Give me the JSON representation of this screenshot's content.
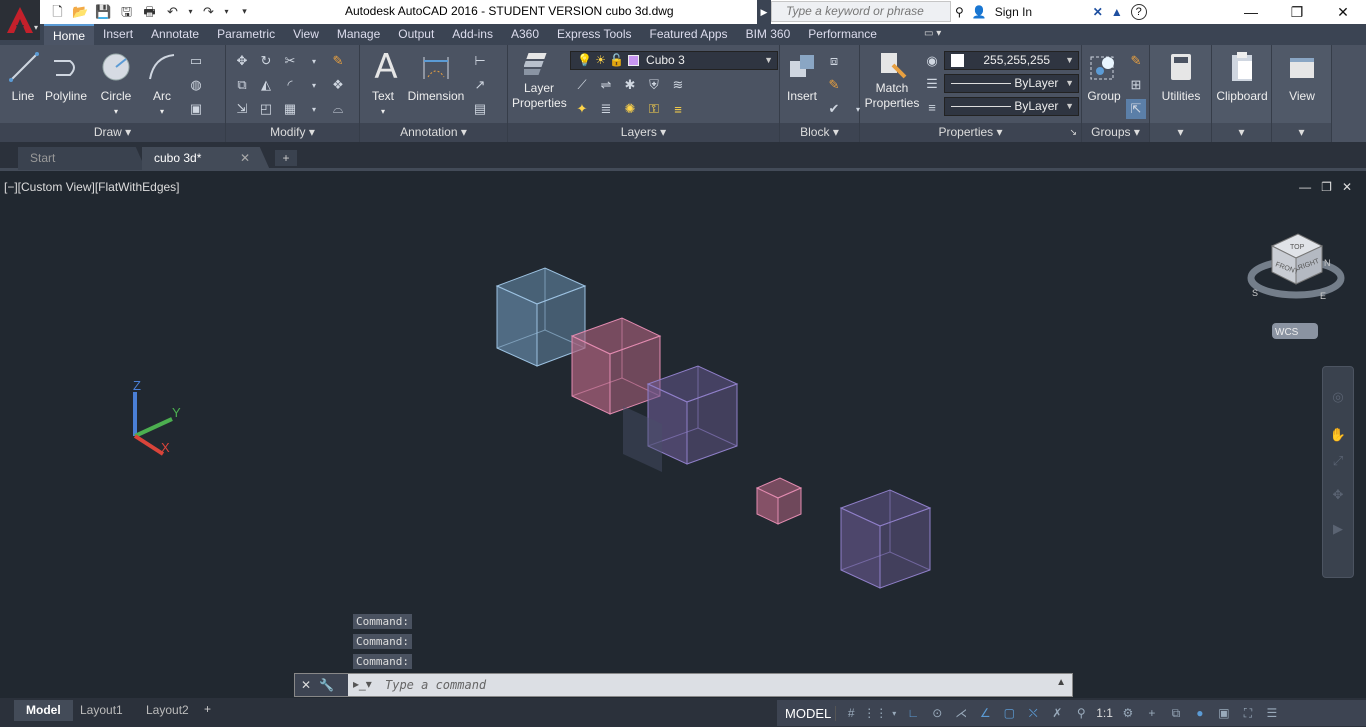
{
  "window": {
    "title": "Autodesk AutoCAD 2016 - STUDENT VERSION    cubo 3d.dwg",
    "search_placeholder": "Type a keyword or phrase",
    "sign_in": "Sign In"
  },
  "ribbon_tabs": [
    "Home",
    "Insert",
    "Annotate",
    "Parametric",
    "View",
    "Manage",
    "Output",
    "Add-ins",
    "A360",
    "Express Tools",
    "Featured Apps",
    "BIM 360",
    "Performance"
  ],
  "panels": {
    "draw": {
      "title": "Draw",
      "tools": [
        "Line",
        "Polyline",
        "Circle",
        "Arc"
      ]
    },
    "modify": {
      "title": "Modify"
    },
    "annotation": {
      "title": "Annotation",
      "tools": [
        "Text",
        "Dimension"
      ]
    },
    "layers": {
      "title": "Layers",
      "layer_properties": "Layer Properties",
      "current_layer": "Cubo 3"
    },
    "block": {
      "title": "Block",
      "insert": "Insert"
    },
    "properties": {
      "title": "Properties",
      "match": "Match Properties",
      "color": "255,255,255",
      "linetype": "ByLayer",
      "lineweight": "ByLayer"
    },
    "groups": {
      "title": "Groups",
      "group": "Group"
    },
    "utilities": {
      "label": "Utilities"
    },
    "clipboard": {
      "label": "Clipboard"
    },
    "view": {
      "label": "View"
    }
  },
  "file_tabs": [
    "Start",
    "cubo 3d*"
  ],
  "viewport": {
    "label": "[−][Custom View][FlatWithEdges]",
    "viewcube": {
      "top": "TOP",
      "front": "FRONT",
      "right": "RIGHT",
      "compass": [
        "N",
        "S",
        "E"
      ],
      "wcs": "WCS"
    },
    "ucs": {
      "x": "X",
      "y": "Y",
      "z": "Z"
    }
  },
  "command": {
    "history": [
      "Command:",
      "Command:",
      "Command:"
    ],
    "placeholder": "Type a command"
  },
  "layout_tabs": [
    "Model",
    "Layout1",
    "Layout2"
  ],
  "status": {
    "model": "MODEL",
    "scale": "1:1"
  },
  "colors": {
    "blue_cube": "#6a8fb0",
    "pink_cube": "#b0637f",
    "violet_cube": "#6a5a93"
  }
}
